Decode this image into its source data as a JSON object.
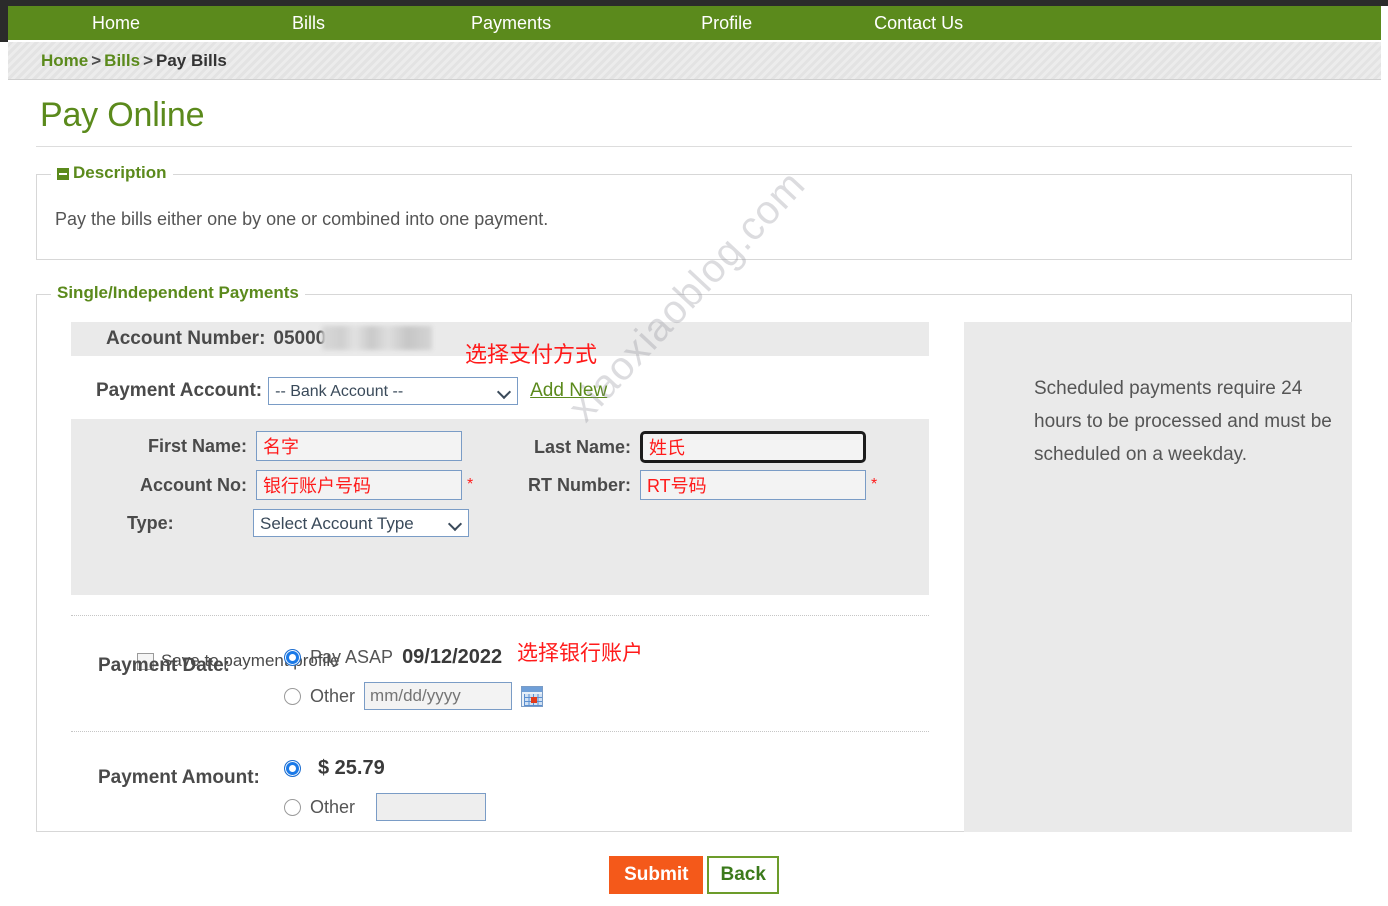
{
  "nav": {
    "items": [
      {
        "label": "Home"
      },
      {
        "label": "Bills"
      },
      {
        "label": "Payments"
      },
      {
        "label": "Profile"
      },
      {
        "label": "Contact Us"
      }
    ]
  },
  "breadcrumb": {
    "home": "Home",
    "sep1": ">",
    "bills": "Bills",
    "sep2": ">",
    "current": "Pay Bills"
  },
  "page": {
    "title": "Pay Online"
  },
  "description": {
    "legend": "Description",
    "text": "Pay the bills either one by one or combined into one payment."
  },
  "payments": {
    "legend": "Single/Independent Payments",
    "account": {
      "label": "Account Number:",
      "value": "05000"
    },
    "payment_account": {
      "label": "Payment Account:",
      "selected": "-- Bank Account --",
      "add_new": "Add New"
    },
    "annotations": {
      "payment_method": "选择支付方式",
      "bank_account": "选择银行账户"
    },
    "bank": {
      "first_name_label": "First Name:",
      "first_name_value": "名字",
      "last_name_label": "Last Name:",
      "last_name_value": "姓氏",
      "account_no_label": "Account No:",
      "account_no_value": "银行账户号码",
      "rt_number_label": "RT Number:",
      "rt_number_value": "RT号码",
      "required_mark": "*",
      "type_label": "Type:",
      "type_selected": "Select Account Type",
      "save_profile_label": "Save to payment profile"
    },
    "payment_date": {
      "label": "Payment Date:",
      "asap_label": "Pay ASAP",
      "asap_date": "09/12/2022",
      "other_label": "Other",
      "other_placeholder": "mm/dd/yyyy",
      "other_value": ""
    },
    "payment_amount": {
      "label": "Payment Amount:",
      "default_amount": "$ 25.79",
      "other_label": "Other",
      "other_value": ""
    },
    "info_panel": {
      "text": "Scheduled payments require 24 hours to be processed and must be scheduled on a weekday."
    }
  },
  "buttons": {
    "submit": "Submit",
    "back": "Back"
  },
  "watermark": {
    "text": "xiaoxiaoblog.com"
  },
  "colors": {
    "nav_green": "#5b8a1c",
    "accent_orange": "#f4591a",
    "annotation_red": "#ff1a1a",
    "panel_grey": "#eaeaea"
  }
}
